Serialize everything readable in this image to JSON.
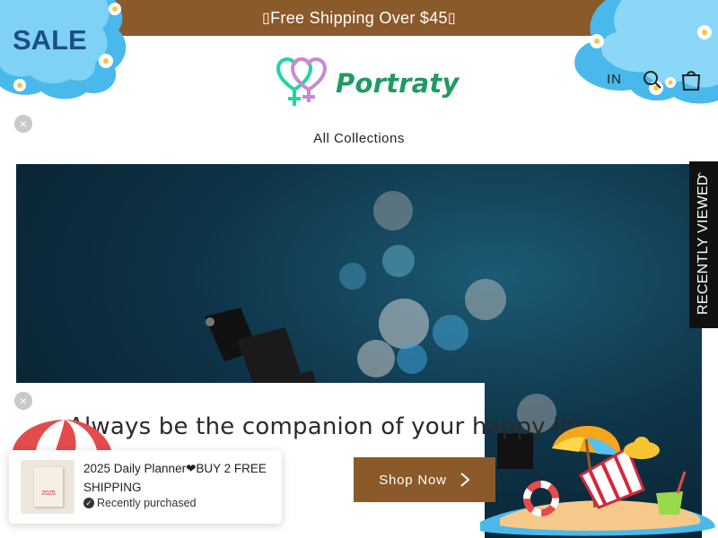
{
  "announcement": {
    "text": "Free Shipping Over $45",
    "glyph_left": "▯",
    "glyph_right": "▯"
  },
  "sale_badge": "SALE",
  "brand": {
    "logo_text": "Portraty",
    "logo_icon": "gender-hearts-icon",
    "green": "#1f9a63",
    "pink": "#c78ad6"
  },
  "header": {
    "signin_label": "IN",
    "search_icon": "search-icon",
    "cart_icon": "cart-icon"
  },
  "nav": {
    "items": [
      "All Collections"
    ]
  },
  "recently_viewed": {
    "label": "RECENTLY VIEWED",
    "chevron": "‹"
  },
  "promo": {
    "close_glyph": "×",
    "title": "Always be the companion of your happy life",
    "button_label": "Shop Now",
    "button_arrow": "›"
  },
  "toast": {
    "title": "2025 Daily Planner❤BUY 2 FREE SHIPPING",
    "status": "Recently purchased",
    "check_glyph": "✓",
    "thumb_year": "2025"
  },
  "colors": {
    "accent_brown": "#8b5a2b",
    "splash_blue": "#49b9ec",
    "hero_dark": "#0a2433"
  }
}
